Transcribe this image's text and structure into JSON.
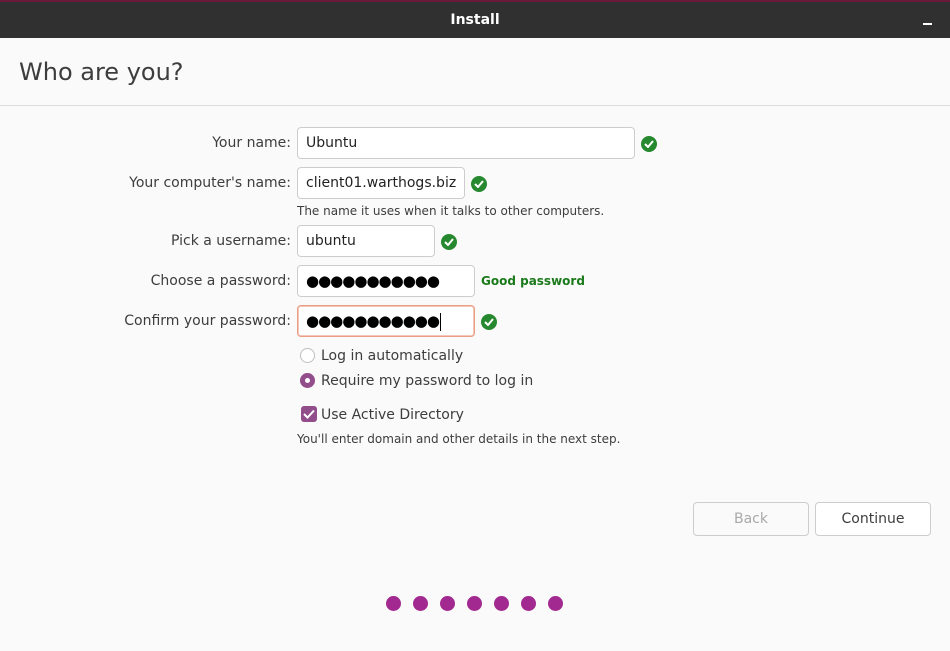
{
  "window": {
    "title": "Install",
    "minimize_icon": "minimize-icon"
  },
  "page": {
    "heading": "Who are you?"
  },
  "form": {
    "your_name": {
      "label": "Your name:",
      "value": "Ubuntu",
      "valid": true
    },
    "computer_name": {
      "label": "Your computer's name:",
      "value": "client01.warthogs.biz",
      "valid": true,
      "hint": "The name it uses when it talks to other computers."
    },
    "username": {
      "label": "Pick a username:",
      "value": "ubuntu",
      "valid": true
    },
    "password": {
      "label": "Choose a password:",
      "value": "●●●●●●●●●●●",
      "strength": "Good password"
    },
    "confirm_password": {
      "label": "Confirm your password:",
      "value": "●●●●●●●●●●●",
      "valid": true,
      "focused": true
    },
    "login_options": [
      {
        "label": "Log in automatically",
        "selected": false
      },
      {
        "label": "Require my password to log in",
        "selected": true
      }
    ],
    "active_directory": {
      "label": "Use Active Directory",
      "checked": true,
      "hint": "You'll enter domain and other details in the next step."
    }
  },
  "buttons": {
    "back": "Back",
    "continue": "Continue"
  },
  "progress": {
    "total_steps": 7
  },
  "colors": {
    "accent": "#924d8b",
    "progress_dot": "#a2298f",
    "valid_green": "#26892f",
    "titlebar": "#303030"
  }
}
